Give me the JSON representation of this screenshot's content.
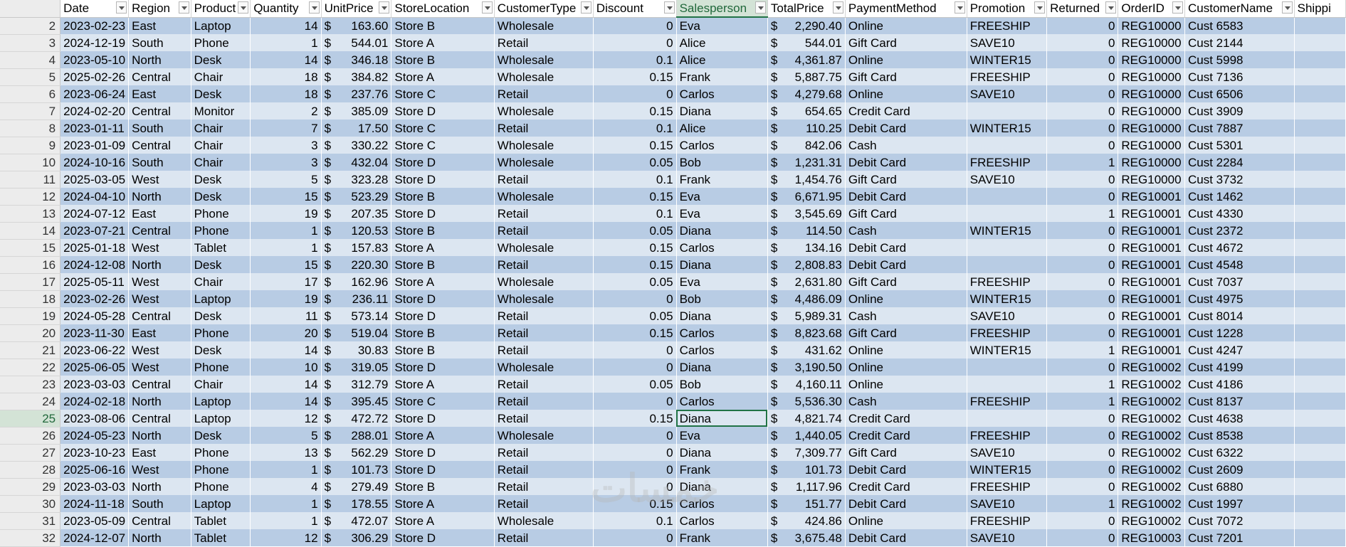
{
  "columns": [
    {
      "label": "Date",
      "align": "left"
    },
    {
      "label": "Region",
      "align": "left"
    },
    {
      "label": "Product",
      "align": "left"
    },
    {
      "label": "Quantity",
      "align": "right"
    },
    {
      "label": "UnitPrice",
      "align": "money"
    },
    {
      "label": "StoreLocation",
      "align": "left"
    },
    {
      "label": "CustomerType",
      "align": "left"
    },
    {
      "label": "Discount",
      "align": "right"
    },
    {
      "label": "Salesperson",
      "align": "left"
    },
    {
      "label": "TotalPrice",
      "align": "money"
    },
    {
      "label": "PaymentMethod",
      "align": "left"
    },
    {
      "label": "Promotion",
      "align": "left"
    },
    {
      "label": "Returned",
      "align": "right"
    },
    {
      "label": "OrderID",
      "align": "left"
    },
    {
      "label": "CustomerName",
      "align": "left"
    },
    {
      "label": "Shippi",
      "align": "left"
    }
  ],
  "selected_column_index": 8,
  "active_row_number": 25,
  "currency_symbol": "$",
  "rows": [
    {
      "n": "2",
      "c": [
        "2023-02-23",
        "East",
        "Laptop",
        "14",
        "163.60",
        "Store B",
        "Wholesale",
        "0",
        "Eva",
        "2,290.40",
        "Online",
        "FREESHIP",
        "0",
        "REG10000",
        "Cust 6583",
        ""
      ]
    },
    {
      "n": "3",
      "c": [
        "2024-12-19",
        "South",
        "Phone",
        "1",
        "544.01",
        "Store A",
        "Retail",
        "0",
        "Alice",
        "544.01",
        "Gift Card",
        "SAVE10",
        "0",
        "REG10000",
        "Cust 2144",
        ""
      ]
    },
    {
      "n": "4",
      "c": [
        "2023-05-10",
        "North",
        "Desk",
        "14",
        "346.18",
        "Store B",
        "Wholesale",
        "0.1",
        "Alice",
        "4,361.87",
        "Online",
        "WINTER15",
        "0",
        "REG10000",
        "Cust 5998",
        ""
      ]
    },
    {
      "n": "5",
      "c": [
        "2025-02-26",
        "Central",
        "Chair",
        "18",
        "384.82",
        "Store A",
        "Wholesale",
        "0.15",
        "Frank",
        "5,887.75",
        "Gift Card",
        "FREESHIP",
        "0",
        "REG10000",
        "Cust 7136",
        ""
      ]
    },
    {
      "n": "6",
      "c": [
        "2023-06-24",
        "East",
        "Desk",
        "18",
        "237.76",
        "Store C",
        "Retail",
        "0",
        "Carlos",
        "4,279.68",
        "Online",
        "SAVE10",
        "0",
        "REG10000",
        "Cust 6506",
        ""
      ]
    },
    {
      "n": "7",
      "c": [
        "2024-02-20",
        "Central",
        "Monitor",
        "2",
        "385.09",
        "Store D",
        "Wholesale",
        "0.15",
        "Diana",
        "654.65",
        "Credit Card",
        "",
        "0",
        "REG10000",
        "Cust 3909",
        ""
      ]
    },
    {
      "n": "8",
      "c": [
        "2023-01-11",
        "South",
        "Chair",
        "7",
        "17.50",
        "Store C",
        "Retail",
        "0.1",
        "Alice",
        "110.25",
        "Debit Card",
        "WINTER15",
        "0",
        "REG10000",
        "Cust 7887",
        ""
      ]
    },
    {
      "n": "9",
      "c": [
        "2023-01-09",
        "Central",
        "Chair",
        "3",
        "330.22",
        "Store C",
        "Wholesale",
        "0.15",
        "Carlos",
        "842.06",
        "Cash",
        "",
        "0",
        "REG10000",
        "Cust 5301",
        ""
      ]
    },
    {
      "n": "10",
      "c": [
        "2024-10-16",
        "South",
        "Chair",
        "3",
        "432.04",
        "Store D",
        "Wholesale",
        "0.05",
        "Bob",
        "1,231.31",
        "Debit Card",
        "FREESHIP",
        "1",
        "REG10000",
        "Cust 2284",
        ""
      ]
    },
    {
      "n": "11",
      "c": [
        "2025-03-05",
        "West",
        "Desk",
        "5",
        "323.28",
        "Store D",
        "Retail",
        "0.1",
        "Frank",
        "1,454.76",
        "Gift Card",
        "SAVE10",
        "0",
        "REG10000",
        "Cust 3732",
        ""
      ]
    },
    {
      "n": "12",
      "c": [
        "2024-04-10",
        "North",
        "Desk",
        "15",
        "523.29",
        "Store B",
        "Wholesale",
        "0.15",
        "Eva",
        "6,671.95",
        "Debit Card",
        "",
        "0",
        "REG10001",
        "Cust 1462",
        ""
      ]
    },
    {
      "n": "13",
      "c": [
        "2024-07-12",
        "East",
        "Phone",
        "19",
        "207.35",
        "Store D",
        "Retail",
        "0.1",
        "Eva",
        "3,545.69",
        "Gift Card",
        "",
        "1",
        "REG10001",
        "Cust 4330",
        ""
      ]
    },
    {
      "n": "14",
      "c": [
        "2023-07-21",
        "Central",
        "Phone",
        "1",
        "120.53",
        "Store B",
        "Retail",
        "0.05",
        "Diana",
        "114.50",
        "Cash",
        "WINTER15",
        "0",
        "REG10001",
        "Cust 2372",
        ""
      ]
    },
    {
      "n": "15",
      "c": [
        "2025-01-18",
        "West",
        "Tablet",
        "1",
        "157.83",
        "Store A",
        "Wholesale",
        "0.15",
        "Carlos",
        "134.16",
        "Debit Card",
        "",
        "0",
        "REG10001",
        "Cust 4672",
        ""
      ]
    },
    {
      "n": "16",
      "c": [
        "2024-12-08",
        "North",
        "Desk",
        "15",
        "220.30",
        "Store B",
        "Retail",
        "0.15",
        "Diana",
        "2,808.83",
        "Debit Card",
        "",
        "0",
        "REG10001",
        "Cust 4548",
        ""
      ]
    },
    {
      "n": "17",
      "c": [
        "2025-05-11",
        "West",
        "Chair",
        "17",
        "162.96",
        "Store A",
        "Wholesale",
        "0.05",
        "Eva",
        "2,631.80",
        "Gift Card",
        "FREESHIP",
        "0",
        "REG10001",
        "Cust 7037",
        ""
      ]
    },
    {
      "n": "18",
      "c": [
        "2023-02-26",
        "West",
        "Laptop",
        "19",
        "236.11",
        "Store D",
        "Wholesale",
        "0",
        "Bob",
        "4,486.09",
        "Online",
        "WINTER15",
        "0",
        "REG10001",
        "Cust 4975",
        ""
      ]
    },
    {
      "n": "19",
      "c": [
        "2024-05-28",
        "Central",
        "Desk",
        "11",
        "573.14",
        "Store D",
        "Retail",
        "0.05",
        "Diana",
        "5,989.31",
        "Cash",
        "SAVE10",
        "0",
        "REG10001",
        "Cust 8014",
        ""
      ]
    },
    {
      "n": "20",
      "c": [
        "2023-11-30",
        "East",
        "Phone",
        "20",
        "519.04",
        "Store B",
        "Retail",
        "0.15",
        "Carlos",
        "8,823.68",
        "Gift Card",
        "FREESHIP",
        "0",
        "REG10001",
        "Cust 1228",
        ""
      ]
    },
    {
      "n": "21",
      "c": [
        "2023-06-22",
        "West",
        "Desk",
        "14",
        "30.83",
        "Store B",
        "Retail",
        "0",
        "Carlos",
        "431.62",
        "Online",
        "WINTER15",
        "1",
        "REG10001",
        "Cust 4247",
        ""
      ]
    },
    {
      "n": "22",
      "c": [
        "2025-06-05",
        "West",
        "Phone",
        "10",
        "319.05",
        "Store D",
        "Wholesale",
        "0",
        "Diana",
        "3,190.50",
        "Online",
        "",
        "0",
        "REG10002",
        "Cust 4199",
        ""
      ]
    },
    {
      "n": "23",
      "c": [
        "2023-03-03",
        "Central",
        "Chair",
        "14",
        "312.79",
        "Store A",
        "Retail",
        "0.05",
        "Bob",
        "4,160.11",
        "Online",
        "",
        "1",
        "REG10002",
        "Cust 4186",
        ""
      ]
    },
    {
      "n": "24",
      "c": [
        "2024-02-18",
        "North",
        "Laptop",
        "14",
        "395.45",
        "Store C",
        "Retail",
        "0",
        "Carlos",
        "5,536.30",
        "Cash",
        "FREESHIP",
        "1",
        "REG10002",
        "Cust 8137",
        ""
      ]
    },
    {
      "n": "25",
      "c": [
        "2023-08-06",
        "Central",
        "Laptop",
        "12",
        "472.72",
        "Store D",
        "Retail",
        "0.15",
        "Diana",
        "4,821.74",
        "Credit Card",
        "",
        "0",
        "REG10002",
        "Cust 4638",
        ""
      ]
    },
    {
      "n": "26",
      "c": [
        "2024-05-23",
        "North",
        "Desk",
        "5",
        "288.01",
        "Store A",
        "Wholesale",
        "0",
        "Eva",
        "1,440.05",
        "Credit Card",
        "FREESHIP",
        "0",
        "REG10002",
        "Cust 8538",
        ""
      ]
    },
    {
      "n": "27",
      "c": [
        "2023-10-23",
        "East",
        "Phone",
        "13",
        "562.29",
        "Store D",
        "Retail",
        "0",
        "Diana",
        "7,309.77",
        "Gift Card",
        "SAVE10",
        "0",
        "REG10002",
        "Cust 6322",
        ""
      ]
    },
    {
      "n": "28",
      "c": [
        "2025-06-16",
        "West",
        "Phone",
        "1",
        "101.73",
        "Store D",
        "Retail",
        "0",
        "Frank",
        "101.73",
        "Debit Card",
        "WINTER15",
        "0",
        "REG10002",
        "Cust 2609",
        ""
      ]
    },
    {
      "n": "29",
      "c": [
        "2023-03-03",
        "North",
        "Phone",
        "4",
        "279.49",
        "Store B",
        "Retail",
        "0",
        "Diana",
        "1,117.96",
        "Credit Card",
        "FREESHIP",
        "0",
        "REG10002",
        "Cust 6880",
        ""
      ]
    },
    {
      "n": "30",
      "c": [
        "2024-11-18",
        "South",
        "Laptop",
        "1",
        "178.55",
        "Store A",
        "Retail",
        "0.15",
        "Carlos",
        "151.77",
        "Debit Card",
        "SAVE10",
        "1",
        "REG10002",
        "Cust 1997",
        ""
      ]
    },
    {
      "n": "31",
      "c": [
        "2023-05-09",
        "Central",
        "Tablet",
        "1",
        "472.07",
        "Store A",
        "Wholesale",
        "0.1",
        "Carlos",
        "424.86",
        "Online",
        "FREESHIP",
        "0",
        "REG10002",
        "Cust 7072",
        ""
      ]
    },
    {
      "n": "32",
      "c": [
        "2024-12-07",
        "North",
        "Tablet",
        "12",
        "306.29",
        "Store D",
        "Retail",
        "0",
        "Frank",
        "3,675.48",
        "Debit Card",
        "SAVE10",
        "0",
        "REG10003",
        "Cust 7201",
        ""
      ]
    }
  ]
}
